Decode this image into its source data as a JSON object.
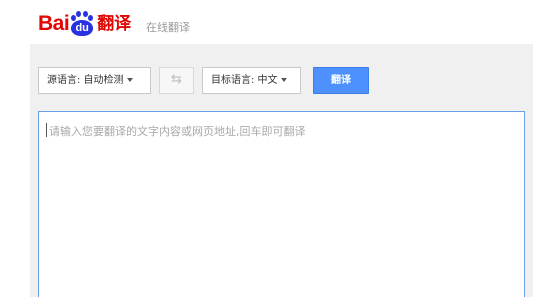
{
  "header": {
    "logo": {
      "latin": "Bai",
      "badge": "du",
      "chinese": "翻译"
    },
    "tagline": "在线翻译",
    "colors": {
      "logo_red": "#e10602",
      "logo_blue": "#2932e1"
    }
  },
  "toolbar": {
    "source_language": "源语言: 自动检测",
    "swap_icon": "swap-arrows-icon",
    "swap_glyph": "⇆",
    "target_language": "目标语言: 中文",
    "translate_label": "翻译",
    "accent_color": "#4d90fe"
  },
  "input": {
    "placeholder": "请输入您要翻译的文字内容或网页地址,回车即可翻译",
    "value": ""
  }
}
